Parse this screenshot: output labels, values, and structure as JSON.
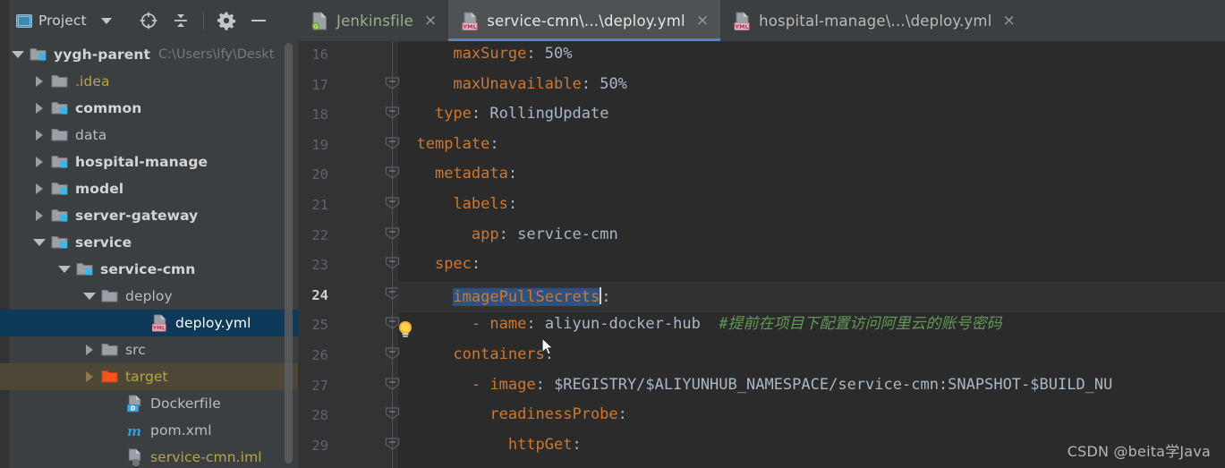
{
  "toolbar": {
    "project_label": "Project",
    "icons": [
      "project-window-icon",
      "dropdown-caret-icon",
      "locate-target-icon",
      "collapse-all-icon",
      "settings-gear-icon",
      "hide-minimize-icon"
    ]
  },
  "tabs": [
    {
      "label": "Jenkinsfile",
      "icon": "groovy-file-icon",
      "active": false,
      "closable": true,
      "close_label": "×"
    },
    {
      "label": "service-cmn\\...\\deploy.yml",
      "icon": "yml-file-icon",
      "active": true,
      "closable": true,
      "close_label": "×"
    },
    {
      "label": "hospital-manage\\...\\deploy.yml",
      "icon": "yml-file-icon",
      "active": false,
      "closable": true,
      "close_label": "×"
    }
  ],
  "tree": [
    {
      "label": "yygh-parent",
      "path": "C:\\Users\\lfy\\Deskt",
      "indent": 12,
      "twisty": "down",
      "icon": "module-folder-icon",
      "style": "module",
      "state": "normal"
    },
    {
      "label": ".idea",
      "indent": 36,
      "twisty": "right",
      "icon": "folder-icon",
      "style": "yellowish",
      "state": "normal"
    },
    {
      "label": "common",
      "indent": 36,
      "twisty": "right",
      "icon": "module-folder-icon",
      "style": "module",
      "state": "normal"
    },
    {
      "label": "data",
      "indent": 36,
      "twisty": "right",
      "icon": "folder-icon",
      "style": "plain",
      "state": "normal"
    },
    {
      "label": "hospital-manage",
      "indent": 36,
      "twisty": "right",
      "icon": "module-folder-icon",
      "style": "module",
      "state": "normal"
    },
    {
      "label": "model",
      "indent": 36,
      "twisty": "right",
      "icon": "module-folder-icon",
      "style": "module",
      "state": "normal"
    },
    {
      "label": "server-gateway",
      "indent": 36,
      "twisty": "right",
      "icon": "module-folder-icon",
      "style": "module",
      "state": "normal"
    },
    {
      "label": "service",
      "indent": 36,
      "twisty": "down",
      "icon": "module-folder-icon",
      "style": "module",
      "state": "normal"
    },
    {
      "label": "service-cmn",
      "indent": 64,
      "twisty": "down",
      "icon": "module-folder-icon",
      "style": "module",
      "state": "normal"
    },
    {
      "label": "deploy",
      "indent": 92,
      "twisty": "down",
      "icon": "folder-icon",
      "style": "plain",
      "state": "normal"
    },
    {
      "label": "deploy.yml",
      "indent": 148,
      "twisty": "none",
      "icon": "yml-file-icon",
      "style": "plain",
      "state": "selected"
    },
    {
      "label": "src",
      "indent": 92,
      "twisty": "right",
      "icon": "folder-icon",
      "style": "plain",
      "state": "normal"
    },
    {
      "label": "target",
      "indent": 92,
      "twisty": "right-dim",
      "icon": "target-folder-icon",
      "style": "yellowish",
      "state": "highlight"
    },
    {
      "label": "Dockerfile",
      "indent": 120,
      "twisty": "none",
      "icon": "docker-file-icon",
      "style": "plain",
      "state": "normal"
    },
    {
      "label": "pom.xml",
      "indent": 120,
      "twisty": "none",
      "icon": "maven-file-icon",
      "style": "plain",
      "state": "normal"
    },
    {
      "label": "service-cmn.iml",
      "indent": 120,
      "twisty": "none",
      "icon": "iml-file-icon",
      "style": "yellowish",
      "state": "normal"
    }
  ],
  "editor": {
    "current_line": 24,
    "selection_text": "imagePullSecrets",
    "lines": [
      {
        "no": 16,
        "indent": 6,
        "text": "maxSurge: 50%",
        "key": "maxSurge",
        "value": "50%"
      },
      {
        "no": 17,
        "indent": 6,
        "text": "maxUnavailable: 50%",
        "key": "maxUnavailable",
        "value": "50%"
      },
      {
        "no": 18,
        "indent": 4,
        "text": "type: RollingUpdate",
        "key": "type",
        "value": "RollingUpdate"
      },
      {
        "no": 19,
        "indent": 2,
        "text": "template:",
        "key": "template",
        "value": ""
      },
      {
        "no": 20,
        "indent": 4,
        "text": "metadata:",
        "key": "metadata",
        "value": ""
      },
      {
        "no": 21,
        "indent": 6,
        "text": "labels:",
        "key": "labels",
        "value": ""
      },
      {
        "no": 22,
        "indent": 8,
        "text": "app: service-cmn",
        "key": "app",
        "value": "service-cmn"
      },
      {
        "no": 23,
        "indent": 4,
        "text": "spec:",
        "key": "spec",
        "value": ""
      },
      {
        "no": 24,
        "indent": 6,
        "text": "imagePullSecrets:",
        "key": "imagePullSecrets",
        "value": ""
      },
      {
        "no": 25,
        "indent": 8,
        "text": "- name: aliyun-docker-hub",
        "key": "name",
        "value": "aliyun-docker-hub",
        "comment": "#提前在项目下配置访问阿里云的账号密码"
      },
      {
        "no": 26,
        "indent": 6,
        "text": "containers:",
        "key": "containers",
        "value": ""
      },
      {
        "no": 27,
        "indent": 8,
        "text": "- image: $REGISTRY/$ALIYUNHUB_NAMESPACE/service-cmn:SNAPSHOT-$BUILD_NU",
        "key": "image",
        "value": "$REGISTRY/$ALIYUNHUB_NAMESPACE/service-cmn:SNAPSHOT-$BUILD_NU"
      },
      {
        "no": 28,
        "indent": 10,
        "text": "readinessProbe:",
        "key": "readinessProbe",
        "value": ""
      },
      {
        "no": 29,
        "indent": 12,
        "text": "httpGet:",
        "key": "httpGet",
        "value": ""
      }
    ]
  },
  "watermark": "CSDN @beita学Java",
  "colors": {
    "background": "#2b2b2b",
    "chrome": "#3c3f41",
    "accent": "#4a88c7",
    "key": "#cc7832",
    "value": "#a9b7c6",
    "comment": "#629755",
    "selection": "#2f5180",
    "tree_selection": "#0d3a58"
  }
}
